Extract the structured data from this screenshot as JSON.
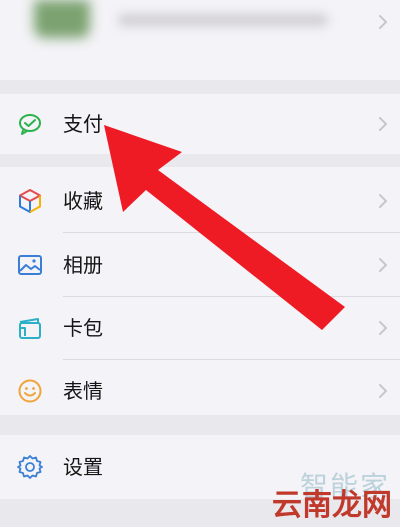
{
  "menu": {
    "pay": {
      "label": "支付",
      "icon": "wechat-pay-icon"
    },
    "favorites": {
      "label": "收藏",
      "icon": "cube-icon"
    },
    "album": {
      "label": "相册",
      "icon": "image-icon"
    },
    "cards": {
      "label": "卡包",
      "icon": "wallet-icon"
    },
    "stickers": {
      "label": "表情",
      "icon": "smiley-icon"
    },
    "settings": {
      "label": "设置",
      "icon": "gear-icon"
    }
  },
  "watermark": {
    "line1": "智能家",
    "line2": "云南龙网"
  },
  "colors": {
    "background": "#e9e8ed",
    "card": "#f4f3f7",
    "arrow": "#ee1b24",
    "pay_green": "#2bb24c"
  }
}
